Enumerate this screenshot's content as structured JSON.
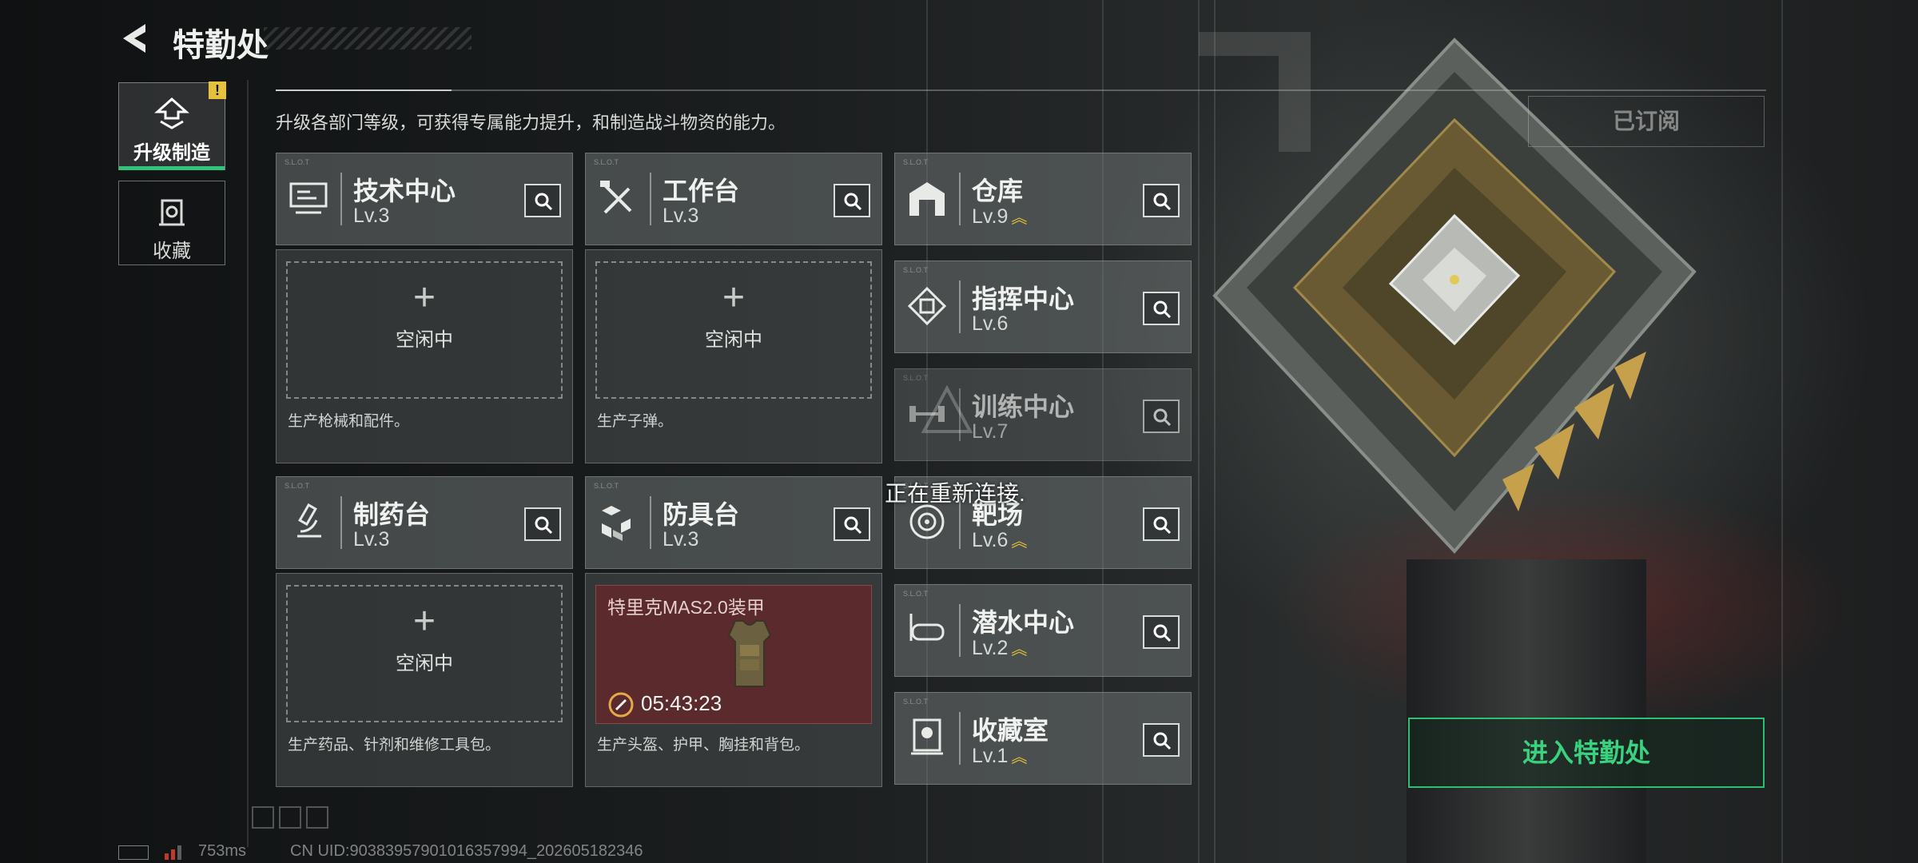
{
  "header": {
    "title": "特勤处",
    "description": "升级各部门等级，可获得专属能力提升，和制造战斗物资的能力。",
    "subscribed_label": "已订阅"
  },
  "tabs": [
    {
      "label": "升级制造",
      "icon": "upgrade-icon",
      "alert": "!"
    },
    {
      "label": "收藏",
      "icon": "collection-icon"
    }
  ],
  "departments": {
    "tech": {
      "name": "技术中心",
      "level": "Lv.3",
      "slot": "空闲中",
      "desc": "生产枪械和配件。"
    },
    "workbench": {
      "name": "工作台",
      "level": "Lv.3",
      "slot": "空闲中",
      "desc": "生产子弹。"
    },
    "pharmacy": {
      "name": "制药台",
      "level": "Lv.3",
      "slot": "空闲中",
      "desc": "生产药品、针剂和维修工具包。"
    },
    "armor": {
      "name": "防具台",
      "level": "Lv.3",
      "desc": "生产头盔、护甲、胸挂和背包。",
      "crafting": {
        "item": "特里克MAS2.0装甲",
        "timer": "05:43:23"
      }
    },
    "warehouse": {
      "name": "仓库",
      "level": "Lv.9"
    },
    "command": {
      "name": "指挥中心",
      "level": "Lv.6"
    },
    "training": {
      "name": "训练中心",
      "level": "Lv.7"
    },
    "range": {
      "name": "靶场",
      "level": "Lv.6"
    },
    "diving": {
      "name": "潜水中心",
      "level": "Lv.2"
    },
    "gallery": {
      "name": "收藏室",
      "level": "Lv.1"
    }
  },
  "reconnect_text": "正在重新连接.",
  "enter_button": "进入特勤处",
  "footer": {
    "ping": "753ms",
    "uid": "CN UID:903839579010163579​94_202605182346"
  },
  "colors": {
    "accent": "#30c47a",
    "upgrade_chevron": "#e5c23a",
    "crafting_bg": "#5a2a2c"
  }
}
